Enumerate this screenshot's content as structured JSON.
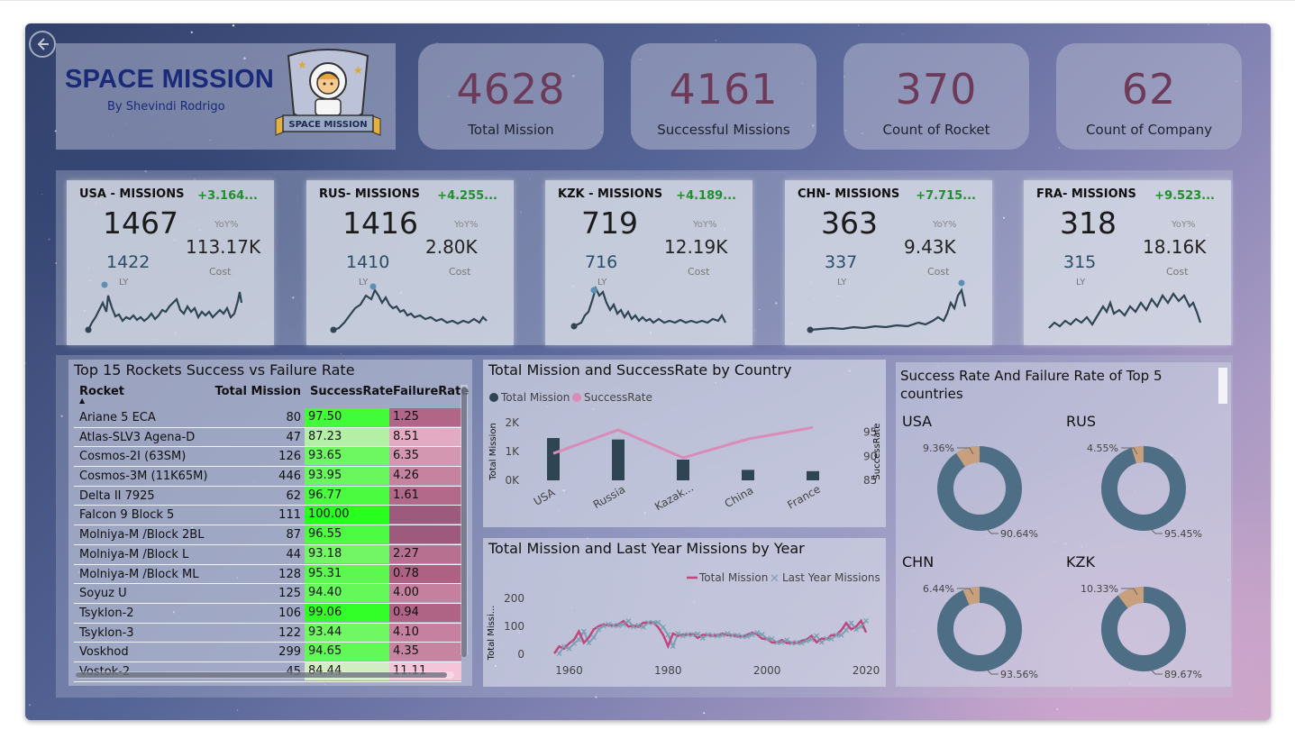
{
  "header": {
    "title": "SPACE MISSION",
    "subtitle": "By Shevindi Rodrigo",
    "logo_text": "SPACE MISSION"
  },
  "kpis": [
    {
      "value": "4628",
      "label": "Total Mission"
    },
    {
      "value": "4161",
      "label": "Successful Missions"
    },
    {
      "value": "370",
      "label": "Count of Rocket"
    },
    {
      "value": "62",
      "label": "Count of Company"
    }
  ],
  "countries": [
    {
      "title": "USA - MISSIONS",
      "missions": "1467",
      "yoy": "+3.164...",
      "yoy_label": "YoY%",
      "cost": "113.17K",
      "cost_label": "Cost",
      "ly": "1422",
      "ly_label": "LY"
    },
    {
      "title": "RUS- MISSIONS",
      "missions": "1416",
      "yoy": "+4.255...",
      "yoy_label": "YoY%",
      "cost": "2.80K",
      "cost_label": "Cost",
      "ly": "1410",
      "ly_label": "LY"
    },
    {
      "title": "KZK - MISSIONS",
      "missions": "719",
      "yoy": "+4.189...",
      "yoy_label": "YoY%",
      "cost": "12.19K",
      "cost_label": "Cost",
      "ly": "716",
      "ly_label": "LY"
    },
    {
      "title": "CHN- MISSIONS",
      "missions": "363",
      "yoy": "+7.715...",
      "yoy_label": "YoY%",
      "cost": "9.43K",
      "cost_label": "Cost",
      "ly": "337",
      "ly_label": "LY"
    },
    {
      "title": "FRA- MISSIONS",
      "missions": "318",
      "yoy": "+9.523...",
      "yoy_label": "YoY%",
      "cost": "18.16K",
      "cost_label": "Cost",
      "ly": "315",
      "ly_label": "LY"
    }
  ],
  "rockets_table": {
    "title": "Top 15 Rockets Success vs Failure Rate",
    "headers": [
      "Rocket",
      "Total Mission",
      "SuccessRate",
      "FailureRate"
    ],
    "rows": [
      {
        "rocket": "Ariane 5 ECA",
        "total": "80",
        "sr": "97.50",
        "fr": "1.25"
      },
      {
        "rocket": "Atlas-SLV3 Agena-D",
        "total": "47",
        "sr": "87.23",
        "fr": "8.51"
      },
      {
        "rocket": "Cosmos-2I (63SM)",
        "total": "126",
        "sr": "93.65",
        "fr": "6.35"
      },
      {
        "rocket": "Cosmos-3M (11K65M)",
        "total": "446",
        "sr": "93.95",
        "fr": "4.26"
      },
      {
        "rocket": "Delta II 7925",
        "total": "62",
        "sr": "96.77",
        "fr": "1.61"
      },
      {
        "rocket": "Falcon 9 Block 5",
        "total": "111",
        "sr": "100.00",
        "fr": ""
      },
      {
        "rocket": "Molniya-M /Block 2BL",
        "total": "87",
        "sr": "96.55",
        "fr": ""
      },
      {
        "rocket": "Molniya-M /Block L",
        "total": "44",
        "sr": "93.18",
        "fr": "2.27"
      },
      {
        "rocket": "Molniya-M /Block ML",
        "total": "128",
        "sr": "95.31",
        "fr": "0.78"
      },
      {
        "rocket": "Soyuz U",
        "total": "125",
        "sr": "94.40",
        "fr": "4.00"
      },
      {
        "rocket": "Tsyklon-2",
        "total": "106",
        "sr": "99.06",
        "fr": "0.94"
      },
      {
        "rocket": "Tsyklon-3",
        "total": "122",
        "sr": "93.44",
        "fr": "4.10"
      },
      {
        "rocket": "Voskhod",
        "total": "299",
        "sr": "94.65",
        "fr": "4.35"
      },
      {
        "rocket": "Vostok-2",
        "total": "45",
        "sr": "84.44",
        "fr": "11.11"
      }
    ]
  },
  "colors": {
    "bar": "#2f4553",
    "success_line": "#d98cb8",
    "total_line": "#c2457e",
    "ly_line": "#7aa1b3",
    "donut_main": "#4d6e85",
    "donut_slice": "#c9a07e",
    "yoy_green": "#1f8f2e"
  },
  "chart_data": [
    {
      "type": "bar",
      "title": "Total Mission and SuccessRate by Country",
      "legend": [
        "Total Mission",
        "SuccessRate"
      ],
      "categories": [
        "USA",
        "Russia",
        "Kazak...",
        "China",
        "France"
      ],
      "series": [
        {
          "name": "Total Mission",
          "axis": "left",
          "values": [
            1467,
            1416,
            719,
            363,
            318
          ]
        },
        {
          "name": "SuccessRate",
          "axis": "right",
          "type": "line",
          "values": [
            90.6,
            95.5,
            89.7,
            93.6,
            96.0
          ]
        }
      ],
      "ylabel": "Total Mission",
      "y2label": "SuccessRate",
      "yticks": [
        "2K",
        "1K",
        "0K"
      ],
      "y2ticks": [
        "95",
        "90",
        "85"
      ],
      "ylim": [
        0,
        2000
      ],
      "y2lim": [
        85,
        97
      ]
    },
    {
      "type": "line",
      "title": "Total Mission and Last Year Missions by Year",
      "legend": [
        "Total Mission",
        "Last Year Missions"
      ],
      "ylabel": "Total Missi...",
      "xticks": [
        "1960",
        "1980",
        "2000",
        "2020"
      ],
      "yticks": [
        "200",
        "100",
        "0"
      ],
      "xlim": [
        1955,
        2022
      ],
      "ylim": [
        0,
        200
      ],
      "x": [
        1957,
        1958,
        1959,
        1960,
        1961,
        1962,
        1963,
        1964,
        1965,
        1966,
        1967,
        1968,
        1969,
        1970,
        1971,
        1972,
        1973,
        1974,
        1975,
        1976,
        1977,
        1978,
        1979,
        1980,
        1981,
        1982,
        1983,
        1984,
        1985,
        1986,
        1987,
        1988,
        1989,
        1990,
        1991,
        1992,
        1993,
        1994,
        1995,
        1996,
        1997,
        1998,
        1999,
        2000,
        2001,
        2002,
        2003,
        2004,
        2005,
        2006,
        2007,
        2008,
        2009,
        2010,
        2011,
        2012,
        2013,
        2014,
        2015,
        2016,
        2017,
        2018,
        2019,
        2020
      ],
      "series": [
        {
          "name": "Total Mission",
          "values": [
            3,
            28,
            20,
            39,
            52,
            82,
            41,
            60,
            89,
            101,
            107,
            103,
            103,
            107,
            119,
            99,
            103,
            98,
            113,
            113,
            114,
            97,
            70,
            29,
            74,
            66,
            71,
            70,
            73,
            58,
            70,
            68,
            66,
            69,
            74,
            68,
            68,
            64,
            64,
            70,
            77,
            71,
            56,
            55,
            42,
            43,
            51,
            40,
            42,
            40,
            48,
            53,
            66,
            43,
            56,
            55,
            68,
            69,
            86,
            112,
            89,
            99,
            120,
            78
          ]
        },
        {
          "name": "Last Year Missions",
          "values": [
            null,
            3,
            28,
            20,
            39,
            52,
            82,
            41,
            60,
            89,
            101,
            107,
            103,
            103,
            107,
            119,
            99,
            103,
            98,
            113,
            113,
            114,
            97,
            70,
            29,
            74,
            66,
            71,
            70,
            73,
            58,
            70,
            68,
            66,
            69,
            74,
            68,
            68,
            64,
            64,
            70,
            77,
            71,
            56,
            55,
            42,
            43,
            51,
            40,
            42,
            40,
            48,
            53,
            66,
            43,
            56,
            55,
            68,
            69,
            86,
            112,
            89,
            99,
            120
          ]
        }
      ]
    },
    {
      "type": "pie",
      "title": "Success Rate And Failure Rate of Top 5 countries",
      "charts": [
        {
          "name": "USA",
          "labels": [
            "90.64%",
            "9.36%"
          ],
          "values": [
            90.64,
            9.36
          ]
        },
        {
          "name": "RUS",
          "labels": [
            "95.45%",
            "4.55%"
          ],
          "values": [
            95.45,
            4.55
          ]
        },
        {
          "name": "CHN",
          "labels": [
            "93.56%",
            "6.44%"
          ],
          "values": [
            93.56,
            6.44
          ]
        },
        {
          "name": "KZK",
          "labels": [
            "89.67%",
            "10.33%"
          ],
          "values": [
            89.67,
            10.33
          ]
        }
      ]
    }
  ]
}
